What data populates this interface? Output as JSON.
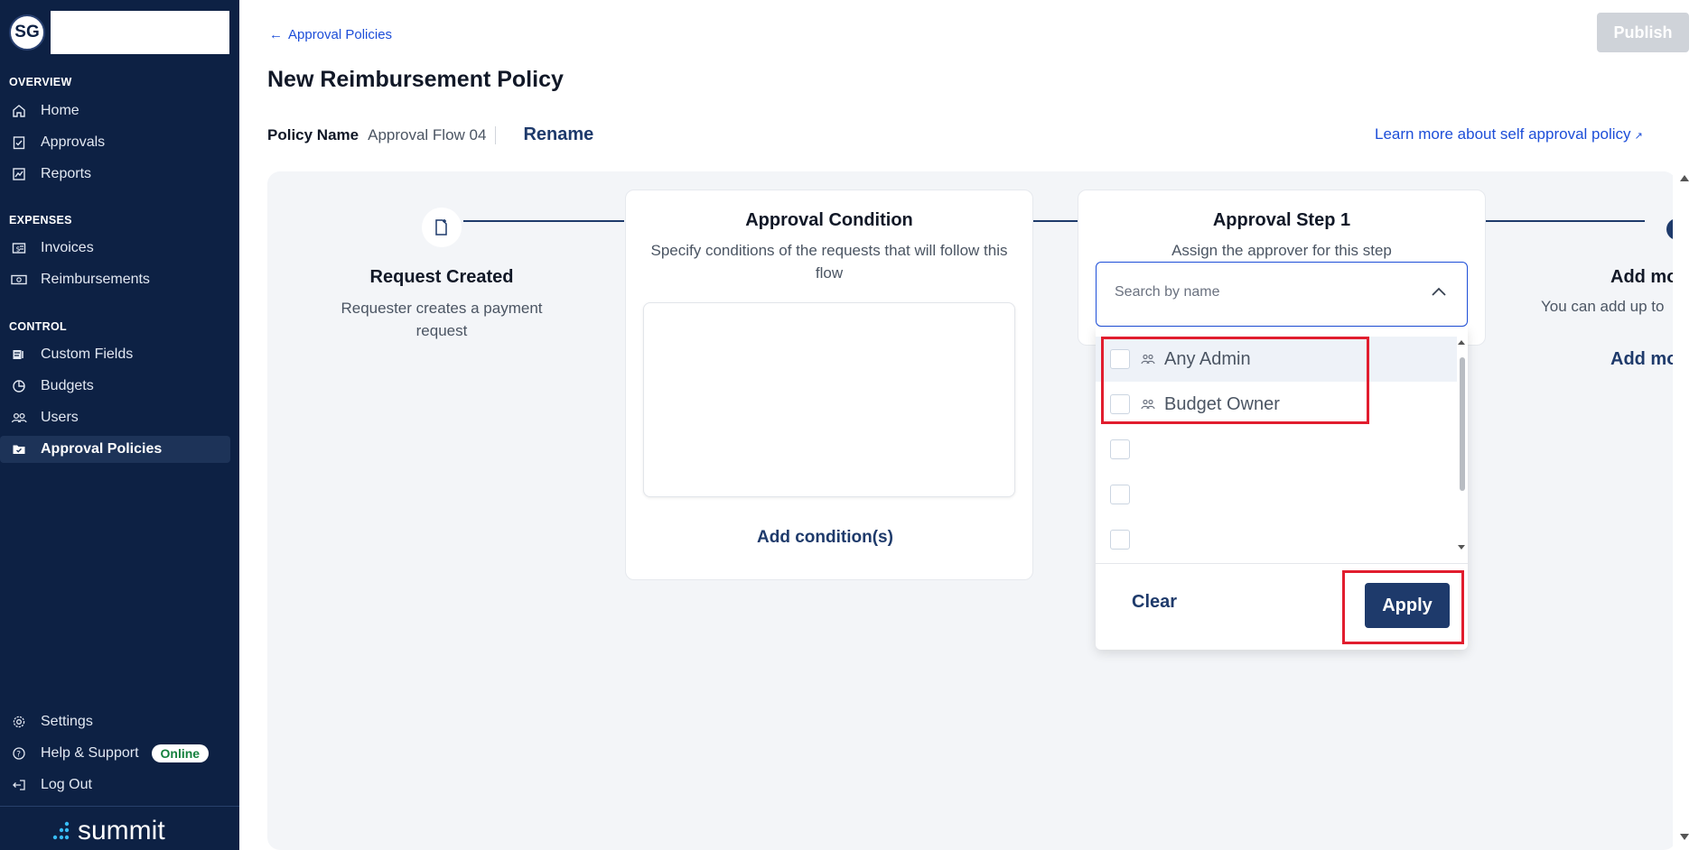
{
  "sidebar": {
    "avatar_initials": "SG",
    "sections": {
      "overview": "OVERVIEW",
      "expenses": "EXPENSES",
      "control": "CONTROL"
    },
    "items": {
      "home": "Home",
      "approvals": "Approvals",
      "reports": "Reports",
      "invoices": "Invoices",
      "reimbursements": "Reimbursements",
      "custom_fields": "Custom Fields",
      "budgets": "Budgets",
      "users": "Users",
      "approval_policies": "Approval Policies",
      "settings": "Settings",
      "help_support": "Help & Support",
      "log_out": "Log Out"
    },
    "online_badge": "Online",
    "brand": "summit",
    "bg_color": "#0d2144"
  },
  "header": {
    "back_link": "Approval Policies",
    "publish_label": "Publish",
    "title": "New Reimbursement Policy",
    "policy_name_label": "Policy Name",
    "policy_name_value": "Approval Flow 04",
    "rename_label": "Rename",
    "learn_more": "Learn more about self approval policy"
  },
  "flow": {
    "request_created": {
      "title": "Request Created",
      "desc": "Requester creates a payment request"
    },
    "approval_condition": {
      "title": "Approval Condition",
      "desc": "Specify conditions of the requests that will follow this flow",
      "add_label": "Add condition(s)"
    },
    "approval_step": {
      "title": "Approval Step 1",
      "desc": "Assign the approver for this step",
      "search_placeholder": "Search by name",
      "options": [
        {
          "label": "Any Admin",
          "checked": false
        },
        {
          "label": "Budget Owner",
          "checked": false
        },
        {
          "label": "",
          "checked": false
        },
        {
          "label": "",
          "checked": false
        },
        {
          "label": "",
          "checked": false
        }
      ],
      "clear_label": "Clear",
      "apply_label": "Apply"
    },
    "add_more": {
      "title": "Add mo",
      "desc": "You can add up to",
      "link": "Add mo"
    }
  },
  "colors": {
    "accent": "#1e3a6b",
    "link": "#1d4ed8",
    "highlight": "#e11d2e"
  }
}
